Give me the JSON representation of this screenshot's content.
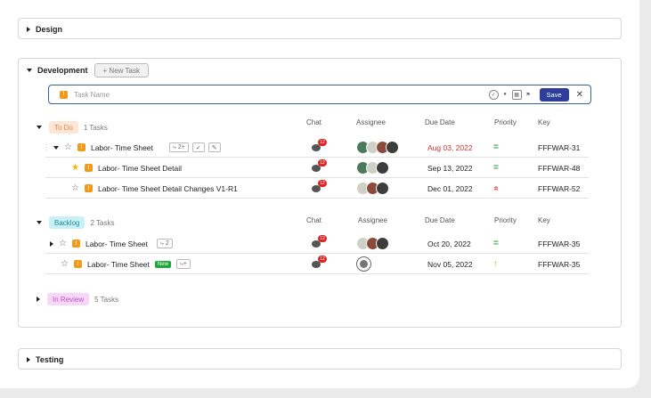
{
  "sections": {
    "design": {
      "title": "Design"
    },
    "development": {
      "title": "Development",
      "new_task_label": "+ New Task"
    },
    "testing": {
      "title": "Testing"
    }
  },
  "task_input": {
    "placeholder": "Task Name",
    "save_label": "Save",
    "close_glyph": "✕"
  },
  "columns": {
    "chat": "Chat",
    "assignee": "Assignee",
    "due_date": "Due Date",
    "priority": "Priority",
    "key": "Key"
  },
  "groups": {
    "todo": {
      "label": "To Do",
      "count": "1 Tasks",
      "color": "#fde6d6",
      "text_color": "#e5864a"
    },
    "backlog": {
      "label": "Backlog",
      "count": "2 Tasks",
      "color": "#c9f1f5",
      "text_color": "#1e8fa3"
    },
    "review": {
      "label": "In Review",
      "count": "5 Tasks",
      "color": "#f6d7f6",
      "text_color": "#c24fc9"
    }
  },
  "todo_rows": [
    {
      "name": "Labor- Time Sheet",
      "subtasks": "2",
      "chat_count": "12",
      "due": "Aug 03, 2022",
      "due_color": "#d32f2f",
      "priority": "normal",
      "priority_glyph": "=",
      "priority_color": "#2fa84f",
      "key": "FFFWAR-31"
    },
    {
      "name": "Labor- Time Sheet Detail",
      "chat_count": "12",
      "due": "Sep 13, 2022",
      "due_color": "#222222",
      "priority": "normal",
      "priority_glyph": "=",
      "priority_color": "#2fa84f",
      "key": "FFFWAR-48"
    },
    {
      "name": "Labor- Time Sheet Detail Changes V1-R1",
      "chat_count": "12",
      "due": "Dec 01, 2022",
      "due_color": "#222222",
      "priority": "urgent",
      "priority_glyph": "«",
      "priority_color": "#e53935",
      "key": "FFFWAR-52"
    }
  ],
  "backlog_rows": [
    {
      "name": "Labor- Time Sheet",
      "subtasks": "2",
      "chat_count": "12",
      "due": "Oct 20, 2022",
      "due_color": "#222222",
      "priority": "normal",
      "priority_glyph": "=",
      "priority_color": "#2fa84f",
      "key": "FFFWAR-35"
    },
    {
      "name": "Labor- Time Sheet",
      "tag": "New",
      "chat_count": "12",
      "due": "Nov 05, 2022",
      "due_color": "#222222",
      "priority": "high",
      "priority_glyph": "↑",
      "priority_color": "#f5a623",
      "key": "FFFWAR-35"
    }
  ]
}
